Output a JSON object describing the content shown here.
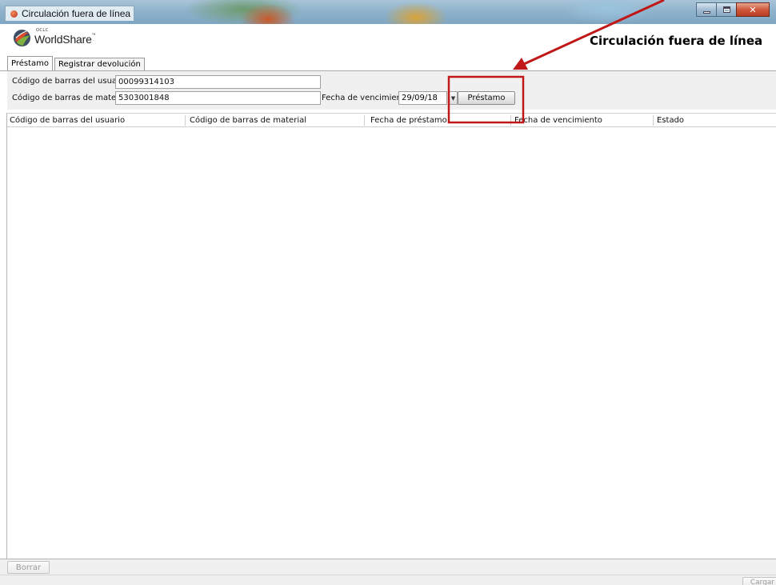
{
  "window": {
    "title": "Circulación fuera de línea",
    "icons": {
      "app": "app-icon",
      "minimize": "minimize-icon",
      "maximize": "maximize-icon",
      "close": "close-icon"
    }
  },
  "header": {
    "logo_small": "OCLC",
    "logo_text": "WorldShare",
    "logo_tm": "™",
    "app_title": "Circulación fuera de línea"
  },
  "tabs": [
    {
      "label": "Préstamo",
      "active": true
    },
    {
      "label": "Registrar devolución",
      "active": false
    }
  ],
  "form": {
    "user_barcode_label": "Código de barras del usuario",
    "user_barcode_value": "00099314103",
    "item_barcode_label": "Código de barras de material",
    "item_barcode_value": "5303001848",
    "due_date_label": "Fecha de vencimiento",
    "due_date_value": "29/09/18",
    "due_date_picker_icon": "calendar-dropdown-icon",
    "checkout_button": "Préstamo"
  },
  "table": {
    "columns": [
      "Código de barras del usuario",
      "Código de barras de material",
      "Fecha de préstamo",
      "Fecha de vencimiento",
      "Estado"
    ],
    "rows": []
  },
  "footer": {
    "clear_button": "Borrar",
    "load_button": "Cargar"
  },
  "colors": {
    "annotation": "#c01818",
    "titlebar": "#8fb3cc",
    "panel": "#f0f0f0"
  }
}
